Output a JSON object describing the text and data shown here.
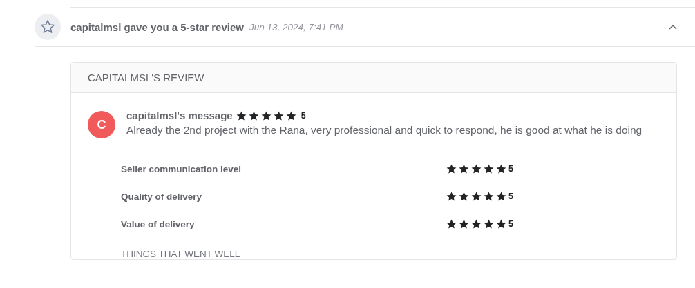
{
  "event": {
    "title": "capitalmsl gave you a 5-star review",
    "time": "Jun 13, 2024, 7:41 PM",
    "expanded": true
  },
  "review": {
    "heading": "CAPITALMSL'S REVIEW",
    "avatar_letter": "C",
    "author": "capitalmsl's message",
    "stars": 5,
    "score": "5",
    "message": "Already the 2nd project with the Rana, very professional and quick to respond, he is good at what he is doing",
    "ratings": [
      {
        "label": "Seller communication level",
        "stars": 5,
        "score": "5"
      },
      {
        "label": "Quality of delivery",
        "stars": 5,
        "score": "5"
      },
      {
        "label": "Value of delivery",
        "stars": 5,
        "score": "5"
      }
    ],
    "section": "THINGS THAT WENT WELL"
  }
}
